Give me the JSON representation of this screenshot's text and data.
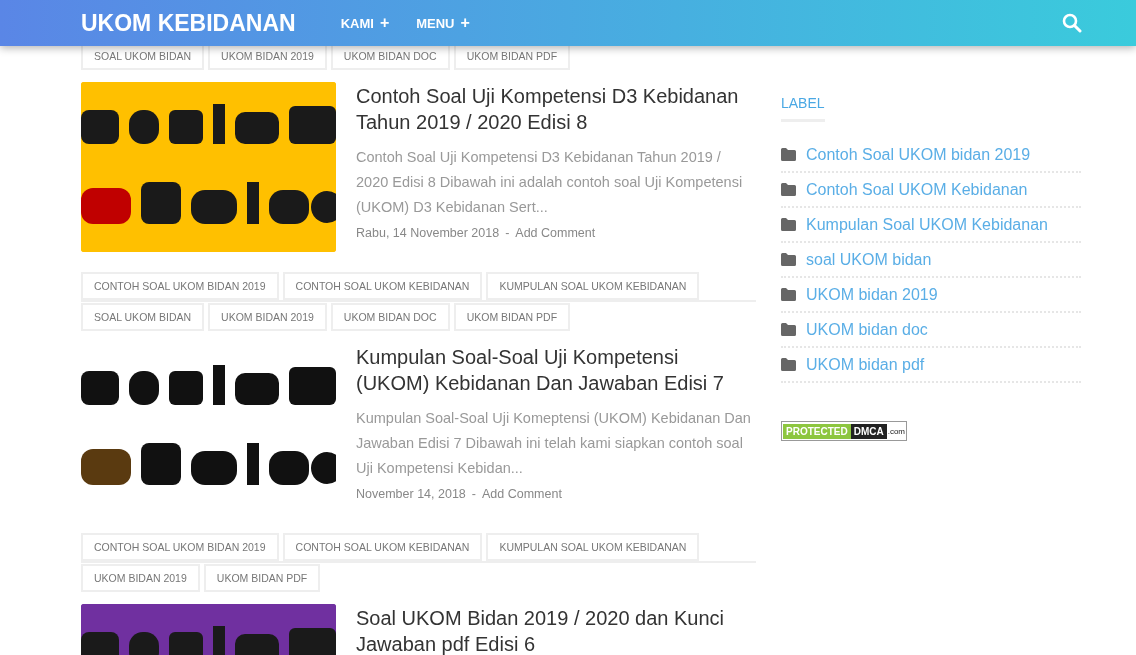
{
  "header": {
    "title": "UKOM KEBIDANAN",
    "nav": [
      {
        "label": "KAMI",
        "toggle": "+"
      },
      {
        "label": "MENU",
        "toggle": "+"
      }
    ]
  },
  "feed": [
    {
      "kind": "tags",
      "tags": [
        "SOAL UKOM BIDAN",
        "UKOM BIDAN 2019",
        "UKOM BIDAN DOC",
        "UKOM BIDAN PDF"
      ]
    },
    {
      "kind": "post",
      "title": "Contoh Soal Uji Kompetensi D3 Kebidanan Tahun 2019 / 2020 Edisi 8",
      "excerpt": "Contoh Soal Uji Kompetensi D3 Kebidanan Tahun 2019 / 2020 Edisi 8 Dibawah ini adalah contoh soal Uji Kompetensi (UKOM) D3 Kebidanan Sert...",
      "date": "Rabu, 14 November 2018",
      "separator": "-",
      "comment": "Add Comment"
    },
    {
      "kind": "tags",
      "tags": [
        "CONTOH SOAL UKOM BIDAN 2019",
        "CONTOH SOAL UKOM KEBIDANAN",
        "KUMPULAN SOAL UKOM KEBIDANAN",
        "SOAL UKOM BIDAN",
        "UKOM BIDAN 2019",
        "UKOM BIDAN DOC",
        "UKOM BIDAN PDF"
      ]
    },
    {
      "kind": "post",
      "title": "Kumpulan Soal-Soal Uji Kompetensi (UKOM) Kebidanan Dan Jawaban Edisi 7",
      "excerpt": "Kumpulan Soal-Soal Uji Komeptensi (UKOM) Kebidanan Dan Jawaban Edisi 7 Dibawah ini telah kami siapkan contoh soal Uji Kompetensi Kebidan...",
      "date": "November 14, 2018",
      "separator": "-",
      "comment": "Add Comment"
    },
    {
      "kind": "tags",
      "tags": [
        "CONTOH SOAL UKOM BIDAN 2019",
        "CONTOH SOAL UKOM KEBIDANAN",
        "KUMPULAN SOAL UKOM KEBIDANAN",
        "UKOM BIDAN 2019",
        "UKOM BIDAN PDF"
      ]
    },
    {
      "kind": "post",
      "title": "Soal UKOM Bidan 2019 / 2020 dan Kunci Jawaban pdf Edisi 6"
    }
  ],
  "sidebar": {
    "label_heading": "LABEL",
    "labels": [
      "Contoh Soal UKOM bidan 2019",
      "Contoh Soal UKOM Kebidanan",
      "Kumpulan Soal UKOM Kebidanan",
      "soal UKOM bidan",
      "UKOM bidan 2019",
      "UKOM bidan doc",
      "UKOM bidan pdf"
    ],
    "badge": {
      "left": "PROTECTED",
      "right": "DMCA",
      "suffix": ".com"
    }
  }
}
